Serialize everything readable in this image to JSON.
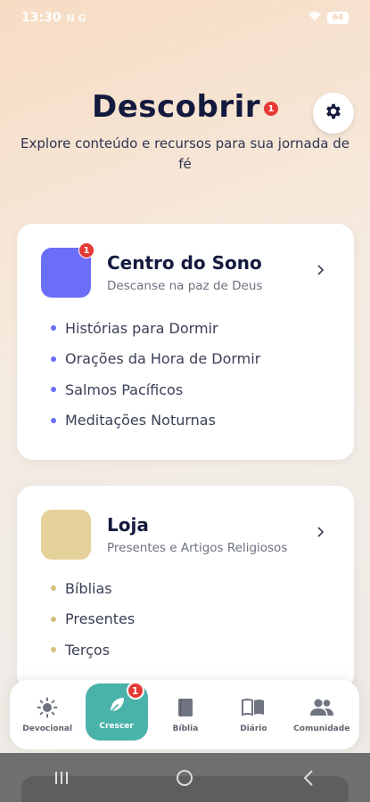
{
  "status_bar": {
    "time": "13:30",
    "indicators": "N G",
    "battery": "64"
  },
  "header": {
    "title": "Descobrir",
    "badge_count": "1",
    "subtitle": "Explore conteúdo e recursos para sua jornada de fé",
    "settings_icon": "gear-icon"
  },
  "cards": [
    {
      "title": "Centro do Sono",
      "subtitle": "Descanse na paz de Deus",
      "icon_color": "#6b6ff7",
      "badge": "1",
      "items": [
        "Histórias para Dormir",
        "Orações da Hora de Dormir",
        "Salmos Pacíficos",
        "Meditações Noturnas"
      ]
    },
    {
      "title": "Loja",
      "subtitle": "Presentes e Artigos Religiosos",
      "icon_color": "#e5d19a",
      "items": [
        "Bíblias",
        "Presentes",
        "Terços"
      ]
    }
  ],
  "bottom_nav": {
    "items": [
      {
        "label": "Devocional",
        "icon": "sun-icon"
      },
      {
        "label": "Crescer",
        "icon": "leaf-icon",
        "active": true,
        "badge": "1"
      },
      {
        "label": "Bíblia",
        "icon": "bible-icon"
      },
      {
        "label": "Diário",
        "icon": "open-book-icon"
      },
      {
        "label": "Comunidade",
        "icon": "people-icon"
      }
    ]
  },
  "colors": {
    "accent_teal": "#49b2a9",
    "badge_red": "#e53935",
    "title_navy": "#141a3e"
  }
}
